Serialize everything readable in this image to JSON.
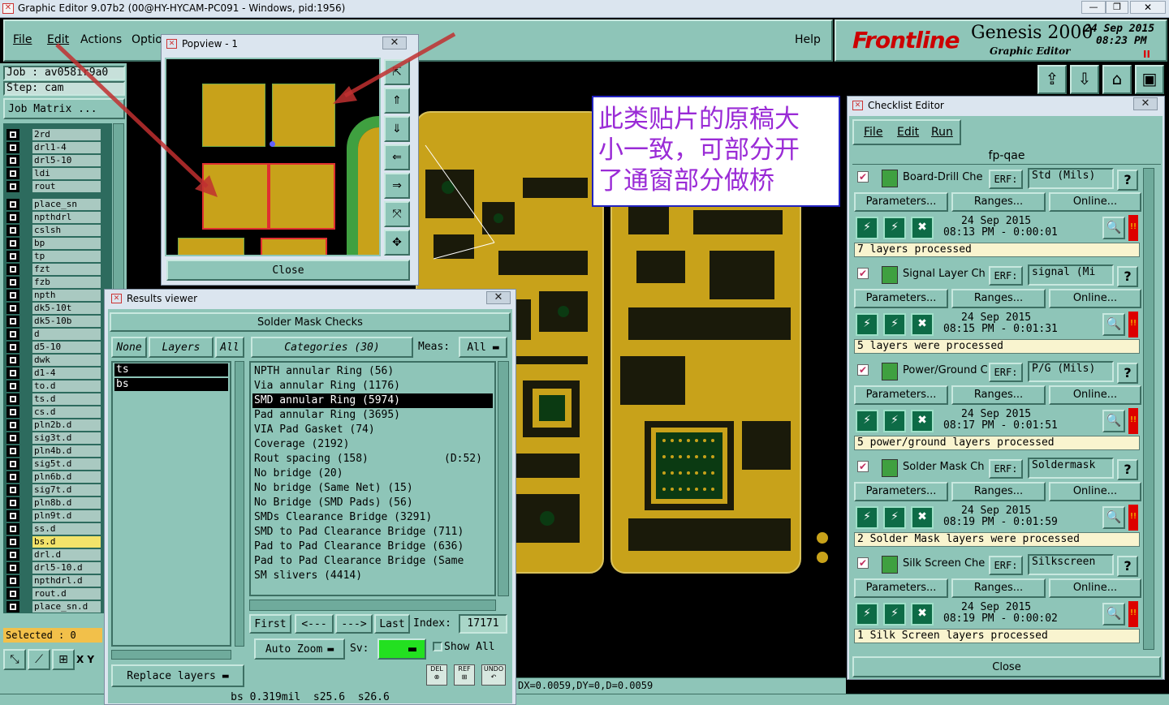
{
  "window": {
    "title": "Graphic Editor 9.07b2 (00@HY-HYCAM-PC091 - Windows, pid:1956)"
  },
  "menu": {
    "items": [
      "File",
      "Edit",
      "Actions",
      "Optio"
    ],
    "help": "Help"
  },
  "brand": {
    "logo": "Frontline",
    "product": "Genesis 2000",
    "subtitle": "Graphic Editor",
    "date": "24 Sep 2015",
    "time": "08:23 PM"
  },
  "job": {
    "job_text": "Job : av058ir9a0",
    "step_text": "Step: cam",
    "matrix_label": "Job Matrix ..."
  },
  "layers": [
    "2rd",
    "drl1-4",
    "drl5-10",
    "ldi",
    "rout",
    "place_sn",
    "npthdrl",
    "cslsh",
    "bp",
    "tp",
    "fzt",
    "fzb",
    "npth",
    "dk5-10t",
    "dk5-10b",
    "d",
    "d5-10",
    "dwk",
    "d1-4",
    "to.d",
    "ts.d",
    "cs.d",
    "pln2b.d",
    "sig3t.d",
    "pln4b.d",
    "sig5t.d",
    "pln6b.d",
    "sig7t.d",
    "pln8b.d",
    "pln9t.d",
    "ss.d",
    "bs.d",
    "drl.d",
    "drl5-10.d",
    "npthdrl.d",
    "rout.d",
    "place_sn.d"
  ],
  "selected": {
    "label": "Selected : 0"
  },
  "bottom_tools": {
    "xy": "X Y"
  },
  "popview": {
    "title": "Popview - 1",
    "close": "Close"
  },
  "annotation": {
    "text_lines": [
      "此类贴片的原稿大",
      "小一致，可部分开",
      "了通窗部分做桥"
    ]
  },
  "coords": {
    "text": "DX=0.0059,DY=0,D=0.0059"
  },
  "results": {
    "title": "Results viewer",
    "heading": "Solder Mask Checks",
    "none": "None",
    "layers": "Layers",
    "all": "All",
    "categories_label": "Categories (30)",
    "meas_label": "Meas:",
    "meas_value": "All",
    "layer_list": [
      "ts",
      "bs"
    ],
    "categories": [
      "NPTH annular Ring (56)",
      "Via annular Ring (1176)",
      "SMD annular Ring (5974)",
      "Pad annular Ring (3695)",
      "VIA Pad Gasket (74)",
      "Coverage (2192)",
      "Rout spacing (158)",
      "No bridge (20)",
      "No bridge (Same Net) (15)",
      "No Bridge (SMD Pads) (56)",
      "SMDs Clearance Bridge (3291)",
      "SMD to Pad Clearance Bridge (711)",
      "Pad to Pad Clearance Bridge (636)",
      "Pad to Pad Clearance Bridge (Same",
      "SM slivers (4414)"
    ],
    "rout_extra": "(D:52)",
    "nav": {
      "first": "First",
      "prev": "<---",
      "next": "--->",
      "last": "Last",
      "index_label": "Index:",
      "index_value": "17171"
    },
    "auto_zoom": "Auto Zoom",
    "sv": "Sv:",
    "show_all": "Show All",
    "replace_layers": "Replace layers",
    "icons": {
      "del": "DEL",
      "ref": "REF",
      "undo": "UNDO"
    },
    "status": "bs 0.319mil  s25.6  s26.6"
  },
  "checklist": {
    "title": "Checklist Editor",
    "menu": [
      "File",
      "Edit",
      "Run"
    ],
    "name": "fp-qae",
    "param_label": "Parameters...",
    "ranges_label": "Ranges...",
    "online_label": "Online...",
    "erf": "ERF:",
    "close": "Close",
    "checks": [
      {
        "name": "Board-Drill Che",
        "erf_value": "Std (Mils)",
        "date": "24 Sep 2015",
        "time": "08:13 PM - 0:00:01",
        "status": "7 layers processed"
      },
      {
        "name": "Signal Layer Ch",
        "erf_value": "signal (Mi",
        "date": "24 Sep 2015",
        "time": "08:15 PM - 0:01:31",
        "status": "5 layers were processed"
      },
      {
        "name": "Power/Ground Cl",
        "erf_value": "P/G (Mils)",
        "date": "24 Sep 2015",
        "time": "08:17 PM - 0:01:51",
        "status": "5 power/ground layers processed"
      },
      {
        "name": "Solder Mask Ch",
        "erf_value": "Soldermask",
        "date": "24 Sep 2015",
        "time": "08:19 PM - 0:01:59",
        "status": "2 Solder Mask layers were processed"
      },
      {
        "name": "Silk Screen Che",
        "erf_value": "Silkscreen",
        "date": "24 Sep 2015",
        "time": "08:19 PM - 0:00:02",
        "status": "1 Silk Screen layers processed"
      }
    ]
  }
}
